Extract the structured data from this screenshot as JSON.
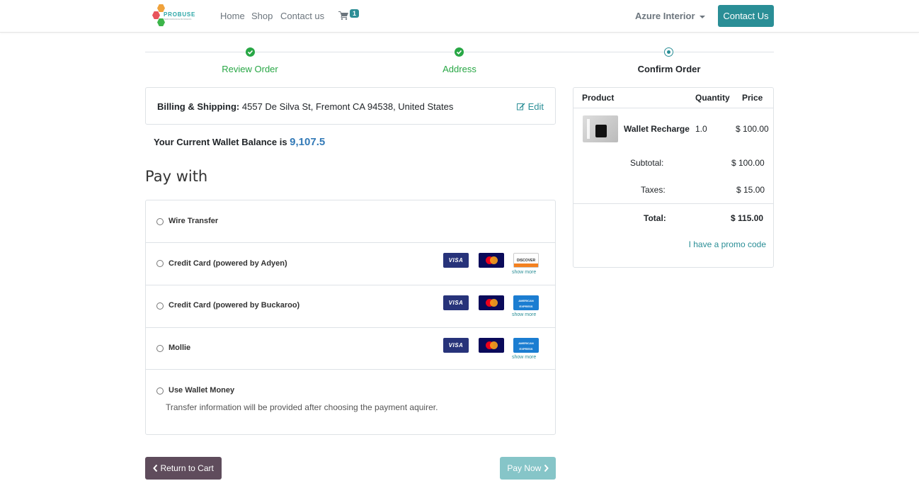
{
  "nav": {
    "logo_text": "PROBUSE",
    "logo_tagline": "PERFORMANCE BUSINESS",
    "links": [
      "Home",
      "Shop",
      "Contact us"
    ],
    "cart_count": "1",
    "company": "Azure Interior",
    "contact_button": "Contact Us"
  },
  "steps": [
    {
      "label": "Review Order",
      "status": "done"
    },
    {
      "label": "Address",
      "status": "done"
    },
    {
      "label": "Confirm Order",
      "status": "active"
    }
  ],
  "billing": {
    "label": "Billing & Shipping:",
    "address": "4557 De Silva St, Fremont CA 94538, United States",
    "edit_label": "Edit"
  },
  "wallet": {
    "label": "Your Current Wallet Balance is",
    "value": "9,107.5"
  },
  "pay_with_title": "Pay with",
  "payment_methods": [
    {
      "label": "Wire Transfer",
      "cards": []
    },
    {
      "label": "Credit Card (powered by Adyen)",
      "cards": [
        "VISA",
        "MasterCard",
        "DISCOVER"
      ],
      "show_more": "show more"
    },
    {
      "label": "Credit Card (powered by Buckaroo)",
      "cards": [
        "VISA",
        "MasterCard",
        "AMERICAN EXPRESS"
      ],
      "show_more": "show more"
    },
    {
      "label": "Mollie",
      "cards": [
        "VISA",
        "MasterCard",
        "AMERICAN EXPRESS"
      ],
      "show_more": "show more"
    },
    {
      "label": "Use Wallet Money",
      "description": "Transfer information will be provided after choosing the payment aquirer."
    }
  ],
  "order": {
    "headers": {
      "product": "Product",
      "quantity": "Quantity",
      "price": "Price"
    },
    "item": {
      "name": "Wallet Recharge",
      "qty": "1.0",
      "price": "$ 100.00"
    },
    "subtotal_label": "Subtotal:",
    "subtotal": "$ 100.00",
    "taxes_label": "Taxes:",
    "taxes": "$ 15.00",
    "total_label": "Total:",
    "total": "$ 115.00",
    "promo": "I have a promo code"
  },
  "buttons": {
    "return": "Return to Cart",
    "pay": "Pay Now"
  },
  "colors": {
    "primary": "#2a8e96",
    "success": "#28a745",
    "return_button": "#5f4c5c",
    "pay_button": "#86c5c8",
    "wallet_value": "#337ab7"
  }
}
